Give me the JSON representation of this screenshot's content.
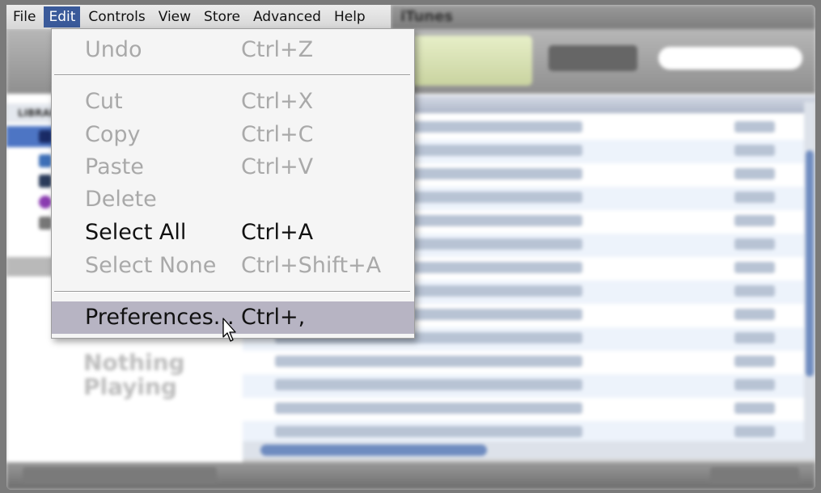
{
  "menubar": {
    "items": [
      "File",
      "Edit",
      "Controls",
      "View",
      "Store",
      "Advanced",
      "Help"
    ],
    "active": "Edit"
  },
  "window": {
    "title": "iTunes"
  },
  "sidebar": {
    "header": "LIBRARY",
    "nothing_playing_1": "Nothing",
    "nothing_playing_2": "Playing"
  },
  "edit_menu": {
    "items": [
      {
        "label": "Undo",
        "shortcut": "Ctrl+Z",
        "state": "disabled"
      },
      {
        "label": "Cut",
        "shortcut": "Ctrl+X",
        "state": "disabled"
      },
      {
        "label": "Copy",
        "shortcut": "Ctrl+C",
        "state": "disabled"
      },
      {
        "label": "Paste",
        "shortcut": "Ctrl+V",
        "state": "disabled"
      },
      {
        "label": "Delete",
        "shortcut": "",
        "state": "disabled"
      },
      {
        "label": "Select All",
        "shortcut": "Ctrl+A",
        "state": "enabled"
      },
      {
        "label": "Select None",
        "shortcut": "Ctrl+Shift+A",
        "state": "disabled"
      },
      {
        "label": "Preferences...",
        "shortcut": "Ctrl+,",
        "state": "hover"
      }
    ]
  },
  "colors": {
    "menu_highlight": "#3a5a9a",
    "hover_row": "#b7b4c3",
    "disabled_text": "#a9a9a9"
  }
}
